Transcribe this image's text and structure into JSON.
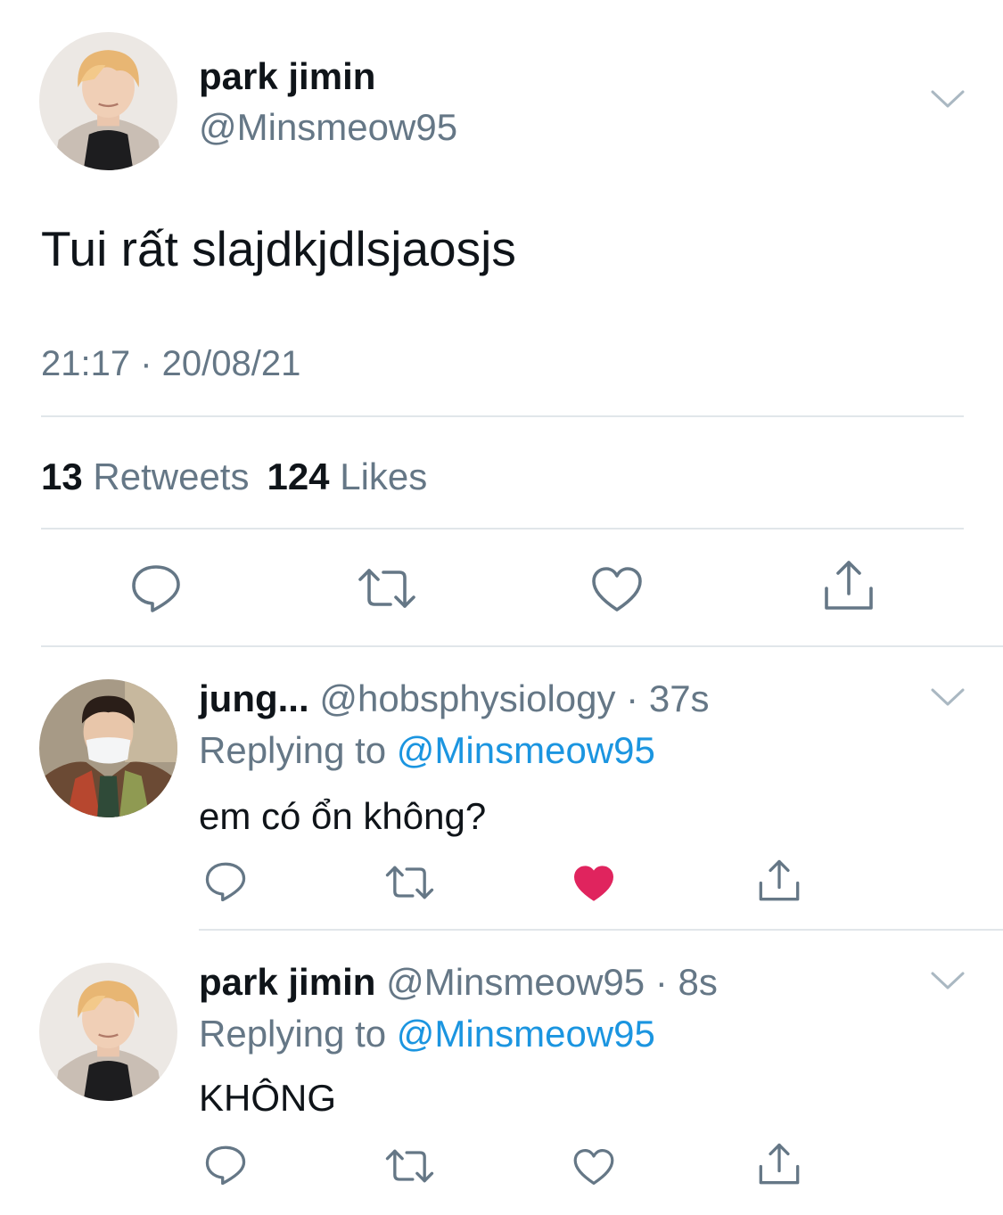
{
  "main_tweet": {
    "name": "park jimin",
    "handle": "@Minsmeow95",
    "text": "Tui rất slajdkjdlsjaosjs",
    "timestamp": "21:17 · 20/08/21",
    "retweets_count": "13",
    "retweets_label": "Retweets",
    "likes_count": "124",
    "likes_label": "Likes",
    "liked": false
  },
  "replies": [
    {
      "name": "jung...",
      "handle": "@hobsphysiology",
      "separator": "·",
      "time": "37s",
      "replying_prefix": "Replying to",
      "replying_to": "@Minsmeow95",
      "text": "em có ổn không?",
      "liked": true
    },
    {
      "name": "park jimin",
      "handle": "@Minsmeow95",
      "separator": "·",
      "time": "8s",
      "replying_prefix": "Replying to",
      "replying_to": "@Minsmeow95",
      "text": "KHÔNG",
      "liked": false
    }
  ],
  "icons": {
    "reply": "reply-icon",
    "retweet": "retweet-icon",
    "like": "heart-icon",
    "share": "share-icon",
    "more": "chevron-down-icon"
  },
  "colors": {
    "text_primary": "#0f1419",
    "text_secondary": "#657786",
    "icon_gray": "#657786",
    "link_blue": "#1b95e0",
    "like_red": "#e0245e",
    "divider": "#e1e6ea"
  }
}
